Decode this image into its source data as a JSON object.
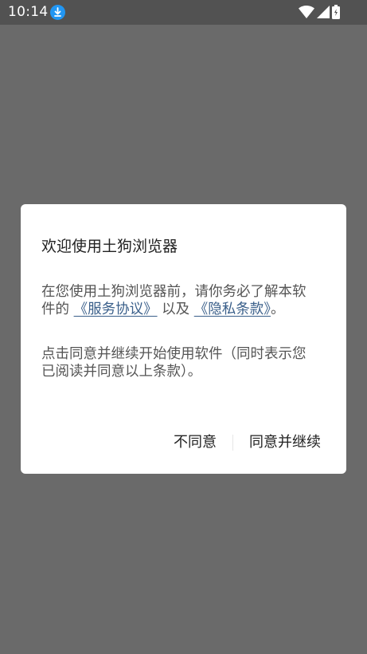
{
  "status_bar": {
    "time": "10:14",
    "icons": [
      "download-icon",
      "wifi-icon",
      "cellular-signal-icon",
      "battery-icon"
    ]
  },
  "dialog": {
    "title": "欢迎使用土狗浏览器",
    "para1_prefix": "在您使用土狗浏览器前，请你务必了解本软件的",
    "service_agreement_link": "《服务协议》",
    "para1_middle": "以及",
    "privacy_policy_link": "《隐私条款》",
    "para1_suffix": "。",
    "para2": "点击同意并继续开始使用软件（同时表示您已阅读并同意以上条款）。",
    "disagree_label": "不同意",
    "agree_label": "同意并继续"
  },
  "colors": {
    "background_dim": "#6a6a6a",
    "status_bar": "#525252",
    "link": "#3a5f8a",
    "download_badge": "#2196f3"
  }
}
